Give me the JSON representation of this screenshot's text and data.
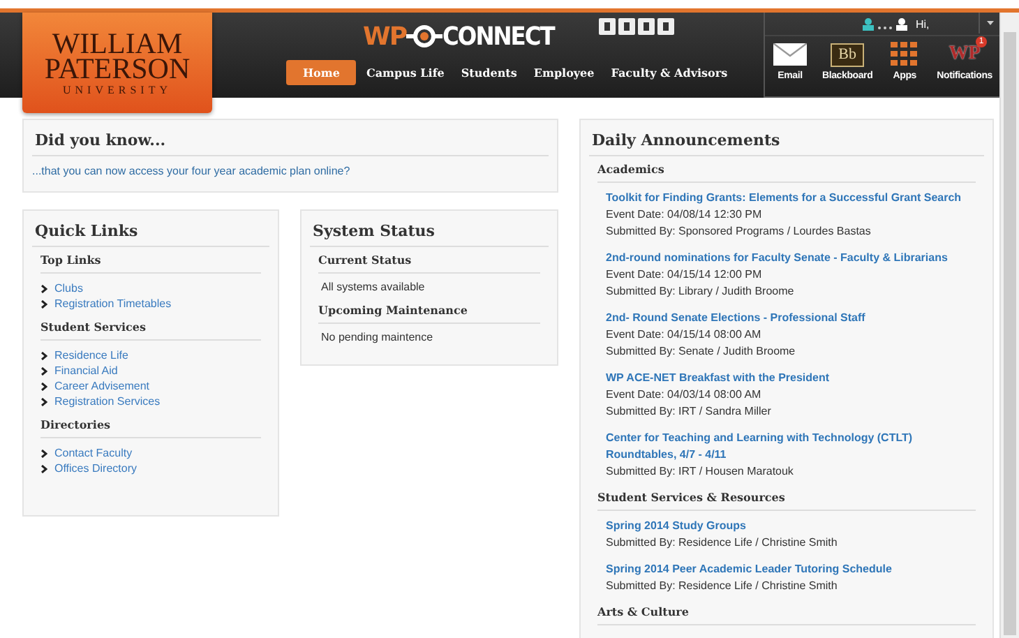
{
  "header": {
    "logo": {
      "line_1": "WILLIAM",
      "line_2": "PATERSON",
      "line_3": "UNIVERSITY"
    },
    "brand": {
      "prefix": "WP",
      "name": "CONNECT"
    },
    "nav": [
      {
        "label": "Home",
        "selected": true
      },
      {
        "label": "Campus Life",
        "selected": false
      },
      {
        "label": "Students",
        "selected": false
      },
      {
        "label": "Employee",
        "selected": false
      },
      {
        "label": "Faculty & Advisors",
        "selected": false
      }
    ],
    "user": {
      "greeting": "Hi,"
    },
    "apps": [
      {
        "kind": "email",
        "label": "Email"
      },
      {
        "kind": "blackboard",
        "label": "Blackboard",
        "icon_text": "Bb"
      },
      {
        "kind": "apps",
        "label": "Apps"
      },
      {
        "kind": "notifications",
        "label": "Notifications",
        "icon_text": "WP",
        "badge": "1"
      }
    ]
  },
  "did_you_know": {
    "title": "Did you know...",
    "text": "...that you can now access your four year academic plan online?"
  },
  "quick_links": {
    "title": "Quick Links",
    "sections": [
      {
        "title": "Top Links",
        "links": [
          "Clubs",
          "Registration Timetables"
        ]
      },
      {
        "title": "Student Services",
        "links": [
          "Residence Life",
          "Financial Aid",
          "Career Advisement",
          "Registration Services"
        ]
      },
      {
        "title": "Directories",
        "links": [
          "Contact Faculty",
          "Offices Directory"
        ]
      }
    ]
  },
  "system_status": {
    "title": "System Status",
    "sections": [
      {
        "title": "Current Status",
        "text": "All systems available"
      },
      {
        "title": "Upcoming Maintenance",
        "text": "No pending maintence"
      }
    ]
  },
  "announcements": {
    "title": "Daily Announcements",
    "categories": [
      {
        "title": "Academics",
        "items": [
          {
            "title": "Toolkit for Finding Grants: Elements for a Successful Grant Search",
            "date": "Event Date: 04/08/14 12:30 PM",
            "submitted": "Submitted By: Sponsored Programs / Lourdes Bastas"
          },
          {
            "title": "2nd-round nominations for Faculty Senate - Faculty & Librarians",
            "date": "Event Date: 04/15/14 12:00 PM",
            "submitted": "Submitted By: Library / Judith Broome"
          },
          {
            "title": "2nd- Round Senate Elections - Professional Staff",
            "date": "Event Date: 04/15/14 08:00 AM",
            "submitted": "Submitted By: Senate / Judith Broome"
          },
          {
            "title": "WP ACE-NET Breakfast with the President",
            "date": "Event Date: 04/03/14 08:00 AM",
            "submitted": "Submitted By: IRT / Sandra Miller"
          },
          {
            "title": "Center for Teaching and Learning with Technology (CTLT) Roundtables, 4/7 - 4/11",
            "submitted": "Submitted By: IRT / Housen Maratouk"
          }
        ]
      },
      {
        "title": "Student Services & Resources",
        "items": [
          {
            "title": "Spring 2014 Study Groups",
            "submitted": "Submitted By: Residence Life / Christine Smith"
          },
          {
            "title": "Spring 2014 Peer Academic Leader Tutoring Schedule",
            "submitted": "Submitted By: Residence Life / Christine Smith"
          }
        ]
      },
      {
        "title": "Arts & Culture"
      }
    ]
  }
}
